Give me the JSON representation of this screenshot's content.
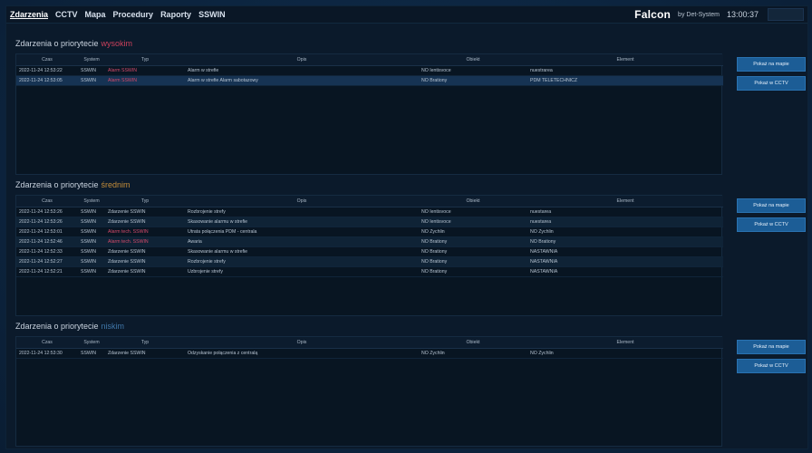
{
  "topbar": {
    "nav": [
      "Zdarzenia",
      "CCTV",
      "Mapa",
      "Procedury",
      "Raporty",
      "SSWIN"
    ],
    "brand": "Falcon",
    "brand_by": "by Det-System",
    "time": "13:00:37"
  },
  "columns": [
    "Czas",
    "System",
    "Typ",
    "Opis",
    "Obiekt",
    "Element"
  ],
  "sections": [
    {
      "title": "Zdarzenia o priorytecie",
      "priority": "wysokim",
      "buttons": [
        "Pokaż na mapie",
        "Pokaż w CCTV"
      ],
      "rows": [
        [
          "2022-11-24 12:53:22",
          "SSWIN",
          "Alarm SSWIN",
          "Alarm w strefie",
          "NO Ientisvoce",
          "nuestrarea"
        ],
        [
          "2022-11-24 12:53:05",
          "SSWIN",
          "Alarm SSWIN",
          "Alarm w strefie Alarm sabotazowy",
          "NO Brationy",
          "PDM TELETECHNICZ"
        ]
      ]
    },
    {
      "title": "Zdarzenia o priorytecie",
      "priority": "średnim",
      "buttons": [
        "Pokaż na mapie",
        "Pokaż w CCTV"
      ],
      "rows": [
        [
          "2022-11-24 12:53:26",
          "SSWIN",
          "Zdarzenie SSWIN",
          "Rozbrojenie strefy",
          "NO Ientisvoce",
          "nuestarea"
        ],
        [
          "2022-11-24 12:53:26",
          "SSWIN",
          "Zdarzenie SSWIN",
          "Skasowanie alarmu w strefie",
          "NO Ientisvoce",
          "nuestarea"
        ],
        [
          "2022-11-24 12:53:01",
          "SSWIN",
          "Alarm tech. SSWIN",
          "Utrata połączenia PDM - centrala",
          "NO Zychlin",
          "NO Zychlin"
        ],
        [
          "2022-11-24 12:52:46",
          "SSWIN",
          "Alarm tech. SSWIN",
          "Awaria",
          "NO Brationy",
          "NO Brationy"
        ],
        [
          "2022-11-24 12:52:33",
          "SSWIN",
          "Zdarzenie SSWIN",
          "Skasowanie alarmu w strefie",
          "NO Brationy",
          "NASTAWNIA"
        ],
        [
          "2022-11-24 12:52:27",
          "SSWIN",
          "Zdarzenie SSWIN",
          "Rozbrojenie strefy",
          "NO Brationy",
          "NASTAWNIA"
        ],
        [
          "2022-11-24 12:52:21",
          "SSWIN",
          "Zdarzenie SSWIN",
          "Uzbrojenie strefy",
          "NO Brationy",
          "NASTAWNIA"
        ]
      ]
    },
    {
      "title": "Zdarzenia o priorytecie",
      "priority": "niskim",
      "buttons": [
        "Pokaż na mapie",
        "Pokaż w CCTV"
      ],
      "rows": [
        [
          "2022-11-24 12:53:30",
          "SSWIN",
          "Zdarzenie SSWIN",
          "Odzyskanie połączenia z centralą",
          "NO Zychlin",
          "NO Zychlin"
        ]
      ]
    }
  ],
  "colors": {
    "alarm_text": "#d54a6a",
    "priority_high": "#c9405b",
    "priority_mid": "#c48d3a",
    "priority_low": "#3f76a8",
    "button_bg": "#1c5d96"
  }
}
